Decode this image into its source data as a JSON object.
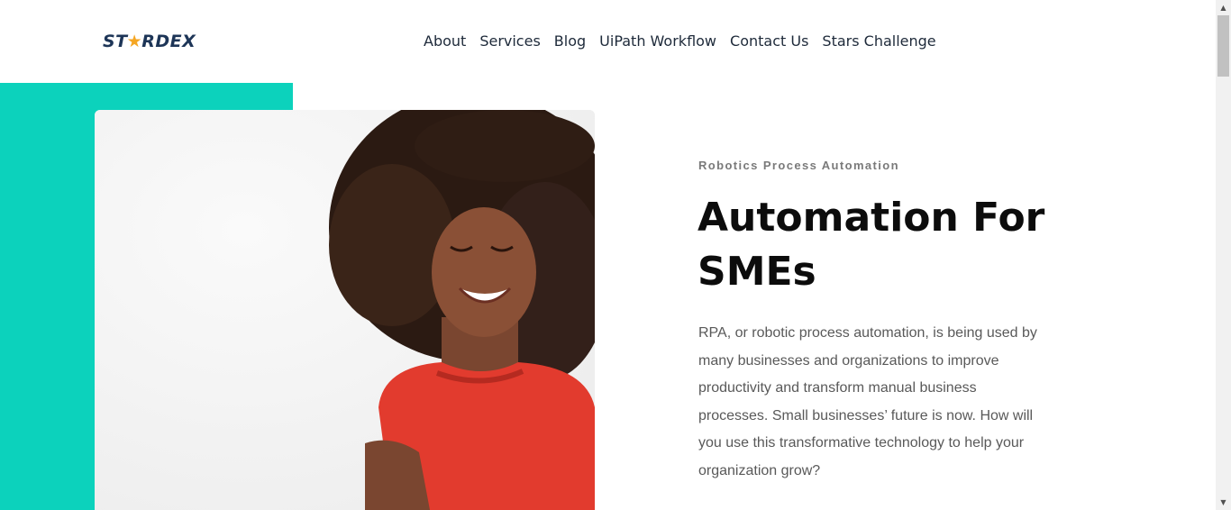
{
  "brand": {
    "logo_prefix": "ST",
    "logo_star": "★",
    "logo_suffix": "RDEX",
    "logo_name": "STARDEX"
  },
  "nav": {
    "items": [
      {
        "label": "About"
      },
      {
        "label": "Services"
      },
      {
        "label": "Blog"
      },
      {
        "label": "UiPath Workflow"
      },
      {
        "label": "Contact Us"
      },
      {
        "label": "Stars Challenge"
      }
    ]
  },
  "hero": {
    "eyebrow": "Robotics Process Automation",
    "headline_line1": "Automation For",
    "headline_line2": "SMEs",
    "body": "RPA, or robotic process automation, is being used by many businesses and organizations to improve productivity and transform manual business processes. Small businesses’ future is now. How will you use this transformative technology to help your organization grow?"
  },
  "colors": {
    "accent_teal": "#0cd2bc",
    "logo_navy": "#1d3557",
    "logo_star": "#f5a623",
    "shirt_red": "#e23b2e"
  },
  "icons": {
    "logo_star": "star-icon",
    "scroll_up": "chevron-up-icon",
    "scroll_down": "chevron-down-icon"
  }
}
